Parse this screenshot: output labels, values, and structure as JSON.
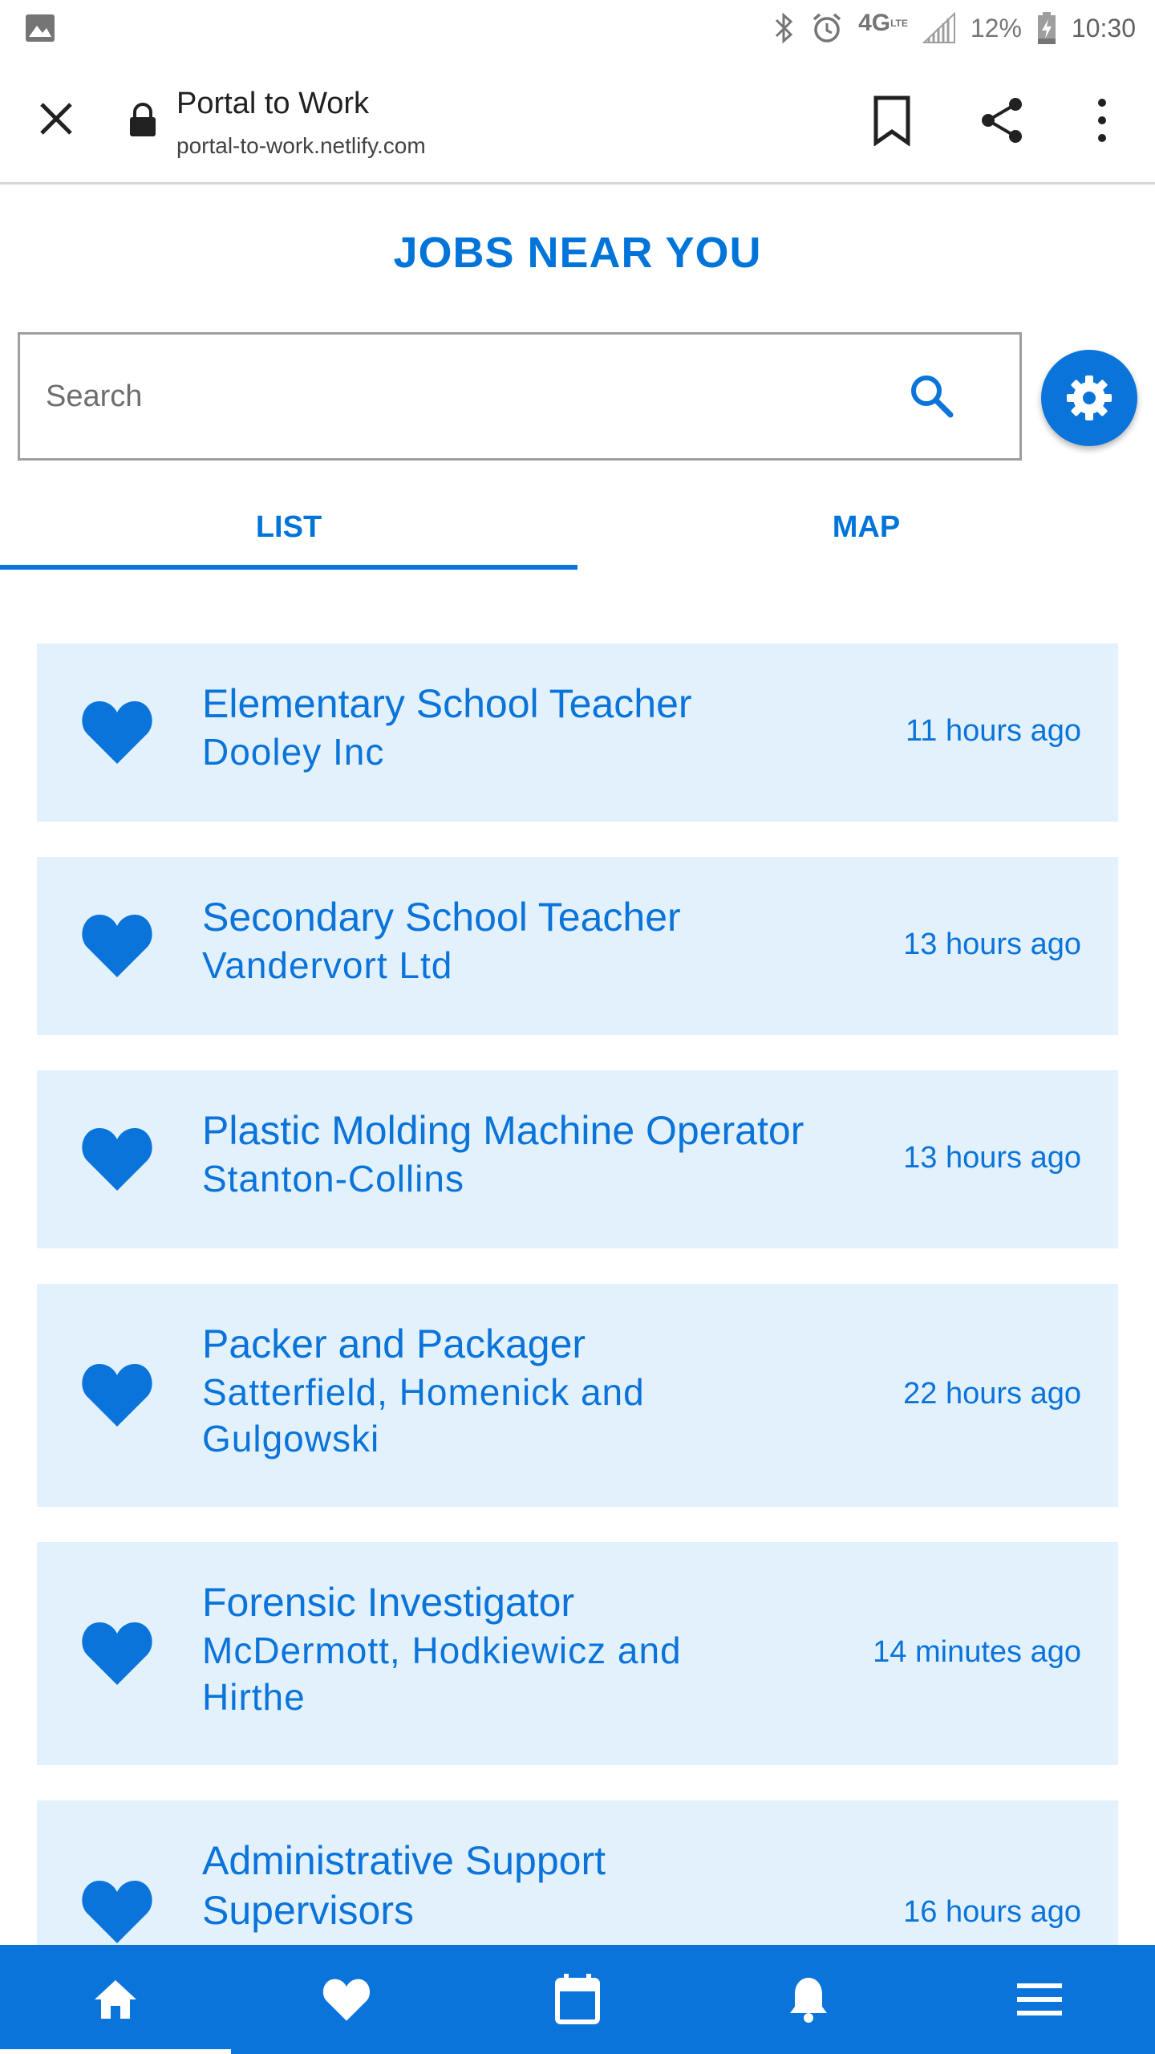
{
  "status_bar": {
    "network": "4G",
    "network_sub": "LTE",
    "battery": "12%",
    "time": "10:30"
  },
  "browser": {
    "page_title": "Portal to Work",
    "url": "portal-to-work.netlify.com"
  },
  "header": {
    "title": "JOBS NEAR YOU"
  },
  "search": {
    "placeholder": "Search"
  },
  "tabs": [
    {
      "label": "LIST",
      "active": true
    },
    {
      "label": "MAP",
      "active": false
    }
  ],
  "jobs": [
    {
      "title": "Elementary School Teacher",
      "company": "Dooley Inc",
      "posted": "11 hours ago"
    },
    {
      "title": "Secondary School Teacher",
      "company": "Vandervort Ltd",
      "posted": "13 hours ago"
    },
    {
      "title": "Plastic Molding Machine Operator",
      "company": "Stanton-Collins",
      "posted": "13 hours ago"
    },
    {
      "title": "Packer and Packager",
      "company": "Satterfield, Homenick and Gulgowski",
      "posted": "22 hours ago"
    },
    {
      "title": "Forensic Investigator",
      "company": "McDermott, Hodkiewicz and Hirthe",
      "posted": "14 minutes ago"
    },
    {
      "title": "Administrative Support Supervisors",
      "company": "",
      "posted": "16 hours ago"
    }
  ],
  "bottom_nav": [
    {
      "icon": "home-icon",
      "active": true
    },
    {
      "icon": "heart-icon",
      "active": false
    },
    {
      "icon": "calendar-icon",
      "active": false
    },
    {
      "icon": "bell-icon",
      "active": false
    },
    {
      "icon": "menu-icon",
      "active": false
    }
  ],
  "colors": {
    "accent": "#0a74da",
    "card_bg": "#e3f1fc",
    "text_dark": "#212121"
  }
}
